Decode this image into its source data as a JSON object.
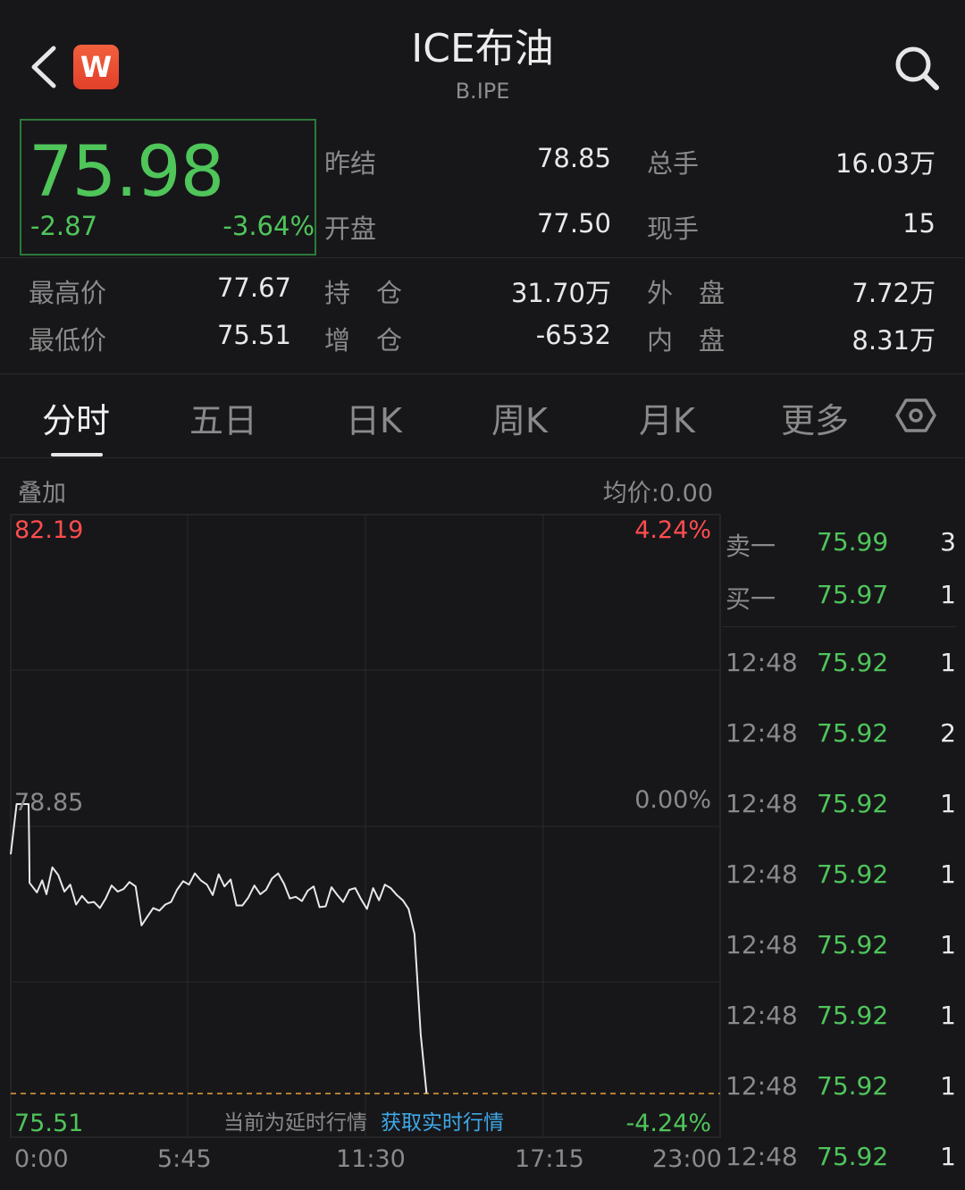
{
  "header": {
    "title": "ICE布油",
    "subtitle": "B.IPE",
    "logo_letter": "W"
  },
  "quote": {
    "price": "75.98",
    "change": "-2.87",
    "change_pct": "-3.64%",
    "stats": [
      {
        "label": "昨结",
        "value": "78.85"
      },
      {
        "label": "总手",
        "value": "16.03万"
      },
      {
        "label": "开盘",
        "value": "77.50"
      },
      {
        "label": "现手",
        "value": "15"
      },
      {
        "label": "最高价",
        "value": "77.67"
      },
      {
        "label": "持　仓",
        "value": "31.70万"
      },
      {
        "label": "外　盘",
        "value": "7.72万"
      },
      {
        "label": "最低价",
        "value": "75.51"
      },
      {
        "label": "增　仓",
        "value": "-6532"
      },
      {
        "label": "内　盘",
        "value": "8.31万"
      }
    ]
  },
  "tabs": [
    "分时",
    "五日",
    "日K",
    "周K",
    "月K",
    "更多"
  ],
  "active_tab": "分时",
  "chart": {
    "overlay_label": "叠加",
    "avg_label": "均价:0.00",
    "y_top": "82.19",
    "y_mid": "78.85",
    "y_bottom": "75.51",
    "pct_top": "4.24%",
    "pct_mid": "0.00%",
    "pct_bottom": "-4.24%",
    "x_labels": [
      "0:00",
      "5:45",
      "11:30",
      "17:15",
      "23:00"
    ],
    "delay_note": "当前为延时行情",
    "realtime_link": "获取实时行情"
  },
  "chart_data": {
    "type": "line",
    "ylim": [
      75.51,
      82.19
    ],
    "reference": 78.85,
    "x_hours": [
      0.0,
      0.19,
      0.39,
      0.58,
      0.6,
      0.61,
      0.85,
      1.02,
      1.16,
      1.35,
      1.54,
      1.74,
      1.93,
      2.12,
      2.31,
      2.51,
      2.7,
      2.89,
      3.08,
      3.27,
      3.47,
      3.66,
      3.85,
      4.05,
      4.24,
      4.43,
      4.62,
      4.82,
      5.01,
      5.2,
      5.39,
      5.59,
      5.78,
      5.97,
      6.16,
      6.36,
      6.55,
      6.74,
      6.93,
      7.13,
      7.32,
      7.51,
      7.7,
      7.9,
      8.09,
      8.28,
      8.47,
      8.67,
      8.86,
      9.05,
      9.24,
      9.44,
      9.63,
      9.82,
      10.01,
      10.21,
      10.4,
      10.59,
      10.78,
      10.98,
      11.17,
      11.36,
      11.55,
      11.75,
      11.94,
      12.13,
      12.32,
      12.52,
      12.71,
      12.9,
      13.09,
      13.29,
      13.48
    ],
    "values": [
      78.27,
      78.85,
      78.85,
      78.85,
      78.35,
      77.94,
      77.83,
      77.97,
      77.81,
      78.12,
      78.03,
      77.84,
      77.92,
      77.69,
      77.79,
      77.71,
      77.72,
      77.65,
      77.76,
      77.91,
      77.84,
      77.87,
      77.95,
      77.9,
      77.45,
      77.55,
      77.65,
      77.62,
      77.69,
      77.72,
      77.86,
      77.96,
      77.92,
      78.05,
      77.97,
      77.92,
      77.8,
      78.04,
      77.9,
      77.98,
      77.68,
      77.68,
      77.77,
      77.91,
      77.81,
      77.86,
      77.99,
      78.05,
      77.93,
      77.76,
      77.78,
      77.73,
      77.85,
      77.9,
      77.66,
      77.67,
      77.89,
      77.8,
      77.72,
      77.86,
      77.88,
      77.75,
      77.64,
      77.88,
      77.74,
      77.92,
      77.88,
      77.8,
      77.74,
      77.64,
      77.35,
      76.2,
      75.51
    ]
  },
  "order_book": {
    "ask": {
      "label": "卖一",
      "price": "75.99",
      "volume": "3"
    },
    "bid": {
      "label": "买一",
      "price": "75.97",
      "volume": "1"
    },
    "trades": [
      {
        "time": "12:48",
        "price": "75.92",
        "volume": "1"
      },
      {
        "time": "12:48",
        "price": "75.92",
        "volume": "2"
      },
      {
        "time": "12:48",
        "price": "75.92",
        "volume": "1"
      },
      {
        "time": "12:48",
        "price": "75.92",
        "volume": "1"
      },
      {
        "time": "12:48",
        "price": "75.92",
        "volume": "1"
      },
      {
        "time": "12:48",
        "price": "75.92",
        "volume": "1"
      },
      {
        "time": "12:48",
        "price": "75.92",
        "volume": "1"
      },
      {
        "time": "12:48",
        "price": "75.92",
        "volume": "1"
      }
    ]
  },
  "colors": {
    "up": "#ff4d4f",
    "down": "#4fc55a",
    "link": "#3fa8e6",
    "background": "#17171a"
  }
}
